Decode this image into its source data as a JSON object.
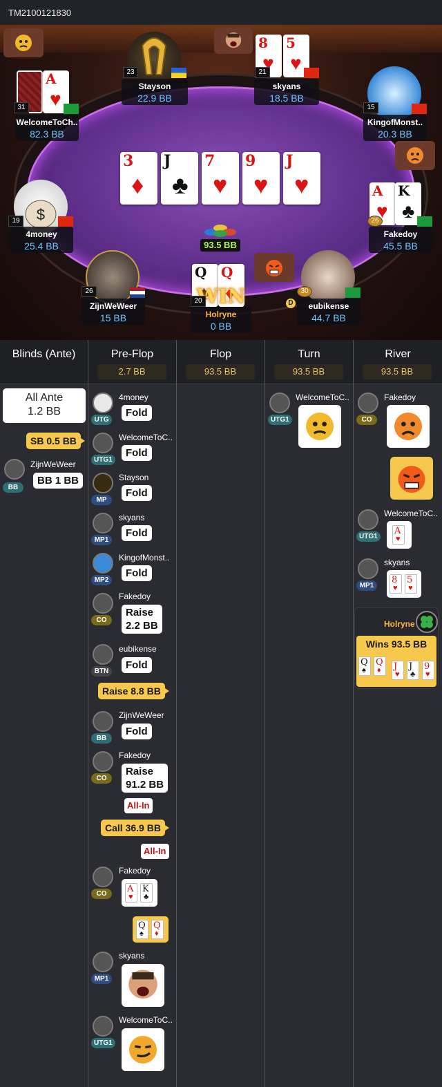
{
  "header": {
    "hand_id": "TM2100121830"
  },
  "table": {
    "board": [
      {
        "rank": "3",
        "suit": "♦",
        "color": "red"
      },
      {
        "rank": "J",
        "suit": "♣",
        "color": "blk"
      },
      {
        "rank": "7",
        "suit": "♥",
        "color": "red"
      },
      {
        "rank": "9",
        "suit": "♥",
        "color": "red"
      },
      {
        "rank": "J",
        "suit": "♥",
        "color": "red"
      }
    ],
    "pot": "93.5 BB",
    "win_label": "WIN",
    "seats": [
      {
        "name": "Stayson",
        "stack": "22.9 BB",
        "level": "23"
      },
      {
        "name": "skyans",
        "stack": "18.5 BB",
        "level": "21"
      },
      {
        "name": "WelcomeToCh..",
        "stack": "82.3 BB",
        "level": "31"
      },
      {
        "name": "KingofMonst..",
        "stack": "20.3 BB",
        "level": "15"
      },
      {
        "name": "4money",
        "stack": "25.4 BB",
        "level": "19"
      },
      {
        "name": "Fakedoy",
        "stack": "45.5 BB",
        "level": "26"
      },
      {
        "name": "ZijnWeWeer",
        "stack": "15 BB",
        "level": "26"
      },
      {
        "name": "Holryne",
        "stack": "0 BB",
        "level": "20"
      },
      {
        "name": "eubikense",
        "stack": "44.7 BB",
        "level": "30"
      }
    ],
    "dealer_label": "D"
  },
  "columns": [
    {
      "title": "Blinds (Ante)",
      "pot": ""
    },
    {
      "title": "Pre-Flop",
      "pot": "2.7 BB"
    },
    {
      "title": "Flop",
      "pot": "93.5 BB"
    },
    {
      "title": "Turn",
      "pot": "93.5 BB"
    },
    {
      "title": "River",
      "pot": "93.5 BB"
    }
  ],
  "blinds": {
    "ante_line1": "All Ante",
    "ante_line2": "1.2 BB",
    "sb": "SB 0.5 BB",
    "bb_player": "ZijnWeWeer",
    "bb_pos": "BB",
    "bb_amount": "BB 1 BB"
  },
  "preflop": [
    {
      "name": "4money",
      "pos": "UTG",
      "action": "Fold"
    },
    {
      "name": "WelcomeToC..",
      "pos": "UTG1",
      "action": "Fold"
    },
    {
      "name": "Stayson",
      "pos": "MP",
      "action": "Fold"
    },
    {
      "name": "skyans",
      "pos": "MP1",
      "action": "Fold"
    },
    {
      "name": "KingofMonst..",
      "pos": "MP2",
      "action": "Fold"
    },
    {
      "name": "Fakedoy",
      "pos": "CO",
      "action": "Raise",
      "action2": "2.2 BB"
    },
    {
      "name": "eubikense",
      "pos": "BTN",
      "action": "Fold"
    },
    {
      "hero_raise": "Raise 8.8 BB"
    },
    {
      "name": "ZijnWeWeer",
      "pos": "BB",
      "action": "Fold"
    },
    {
      "name": "Fakedoy",
      "pos": "CO",
      "action": "Raise",
      "action2": "91.2 BB",
      "allin": "All-In"
    },
    {
      "hero_call": "Call 36.9 BB",
      "allin": "All-In"
    },
    {
      "name": "Fakedoy",
      "pos": "CO"
    },
    {
      "name": "skyans",
      "pos": "MP1"
    },
    {
      "name": "WelcomeToC..",
      "pos": "UTG1"
    }
  ],
  "turn": [
    {
      "name": "WelcomeToC..",
      "pos": "UTG1"
    }
  ],
  "river": [
    {
      "name": "Fakedoy",
      "pos": "CO"
    },
    {
      "name": "WelcomeToC..",
      "pos": "UTG1"
    },
    {
      "name": "skyans",
      "pos": "MP1"
    }
  ],
  "winner": {
    "name": "Holryne",
    "label": "Wins 93.5 BB"
  },
  "colors": {
    "accent": "#f6c84c",
    "felt": "#5f2f8c",
    "stack": "#6ec6ff"
  }
}
